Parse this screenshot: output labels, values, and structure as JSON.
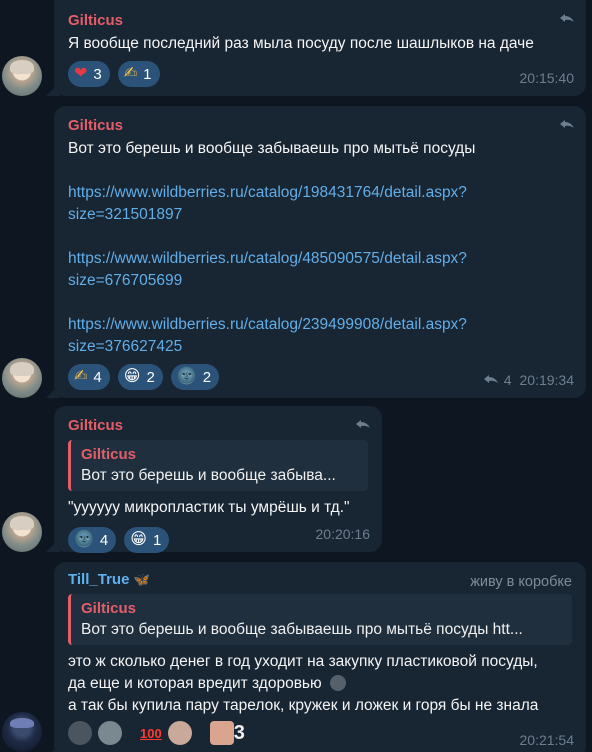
{
  "messages": [
    {
      "author": "Gilticus",
      "text": "Я вообще последний раз мыла посуду после шашлыков на даче",
      "reactions": [
        {
          "emoji": "❤",
          "count": "3"
        },
        {
          "emoji": "✍",
          "count": "1"
        }
      ],
      "time": "20:15:40"
    },
    {
      "author": "Gilticus",
      "text": "Вот это берешь и вообще забываешь про мытьё посуды",
      "links": [
        {
          "line1": "https://www.wildberries.ru/catalog/198431764/detail.aspx?",
          "line2": "size=321501897"
        },
        {
          "line1": "https://www.wildberries.ru/catalog/485090575/detail.aspx?",
          "line2": "size=676705699"
        },
        {
          "line1": "https://www.wildberries.ru/catalog/239499908/detail.aspx?",
          "line2": "size=376627425"
        }
      ],
      "reactions": [
        {
          "emoji": "✍",
          "count": "4"
        },
        {
          "emoji": "😁",
          "count": "2"
        },
        {
          "emoji": "🌚",
          "count": "2"
        }
      ],
      "forwards": "4",
      "time": "20:19:34"
    },
    {
      "author": "Gilticus",
      "quote_author": "Gilticus",
      "quote_text": "Вот это берешь и вообще забыва...",
      "text": "\"уууууу микропластик ты умрёшь и тд.\"",
      "reactions": [
        {
          "emoji": "🌚",
          "count": "4"
        },
        {
          "emoji": "😁",
          "count": "1"
        }
      ],
      "time": "20:20:16"
    },
    {
      "author": "Till_True",
      "author_badge": "🦋",
      "rank": "живу в коробке",
      "quote_author": "Gilticus",
      "quote_text": "Вот это берешь и вообще забываешь про мытьё посуды  htt...",
      "text_lines": [
        "это ж сколько денег в год уходит на закупку пластиковой посуды,",
        "да еще и которая вредит здоровью",
        "а так бы купила пару тарелок, кружек и ложек и горя бы не знала"
      ],
      "reaction_extra": "3",
      "time": "20:21:54"
    }
  ],
  "colors": {
    "background": "#0e1621",
    "bubble": "#182533",
    "author_red": "#e45e68",
    "author_blue": "#5fb0ec",
    "link": "#62aee8",
    "reaction_bg": "#2b5278"
  }
}
